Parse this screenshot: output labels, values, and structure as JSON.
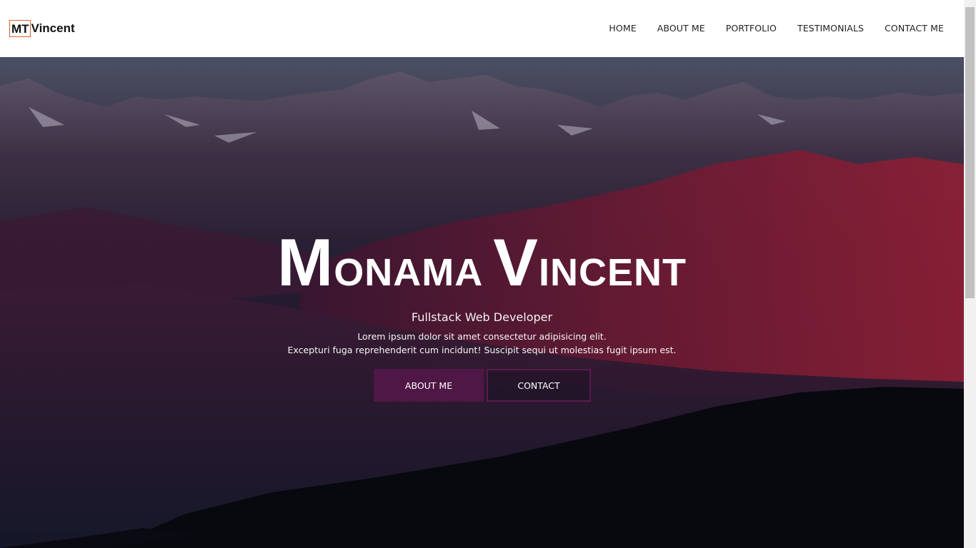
{
  "brand": {
    "boxed": "MT",
    "rest": "Vincent"
  },
  "nav": {
    "items": [
      {
        "label": "HOME"
      },
      {
        "label": "ABOUT ME"
      },
      {
        "label": "PORTFOLIO"
      },
      {
        "label": "TESTIMONIALS"
      },
      {
        "label": "CONTACT ME"
      }
    ]
  },
  "hero": {
    "title_first_cap": "M",
    "title_first_rest": "ONAMA",
    "title_last_cap": "V",
    "title_last_rest": "INCENT",
    "subtitle": "Fullstack Web Developer",
    "text_line1": "Lorem ipsum dolor sit amet consectetur adipisicing elit.",
    "text_line2": "Excepturi fuga reprehenderit cum incidunt! Suscipit sequi ut molestias fugit ipsum est.",
    "buttons": {
      "about": "ABOUT ME",
      "contact": "CONTACT"
    }
  },
  "colors": {
    "accent": "#4f1746",
    "logo_border": "#d9622b",
    "nav_bg": "#ffffff"
  }
}
